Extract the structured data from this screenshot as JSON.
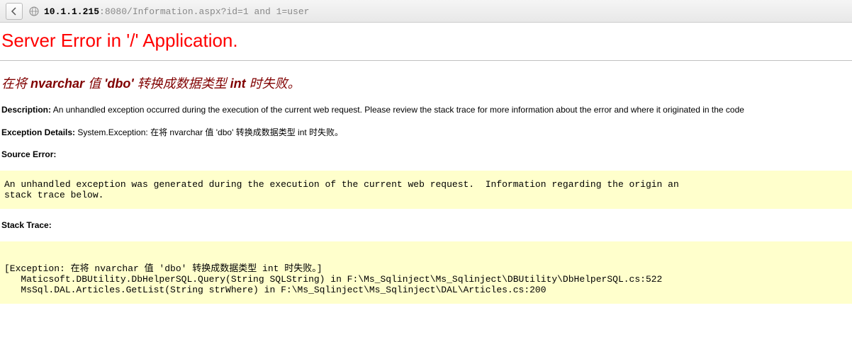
{
  "browser": {
    "url_host": "10.1.1.215",
    "url_path": ":8080/Information.aspx?id=1 and 1=user"
  },
  "error": {
    "title": "Server Error in '/' Application.",
    "message_prefix": "在将 ",
    "message_kw1": "nvarchar",
    "message_mid1": " 值 ",
    "message_kw2": "'dbo'",
    "message_mid2": " 转换成数据类型 ",
    "message_kw3": "int",
    "message_suffix": " 时失败。",
    "description_label": "Description:",
    "description_text": " An unhandled exception occurred during the execution of the current web request. Please review the stack trace for more information about the error and where it originated in the code",
    "exception_label": "Exception Details:",
    "exception_text": " System.Exception: 在将 nvarchar 值 'dbo' 转换成数据类型 int 时失败。",
    "source_error_label": "Source Error:",
    "source_error_block": "An unhandled exception was generated during the execution of the current web request.  Information regarding the origin an\nstack trace below.",
    "stack_trace_label": "Stack Trace:",
    "stack_trace_block": "\n[Exception: 在将 nvarchar 值 'dbo' 转换成数据类型 int 时失败。]\n   Maticsoft.DBUtility.DbHelperSQL.Query(String SQLString) in F:\\Ms_Sqlinject\\Ms_Sqlinject\\DBUtility\\DbHelperSQL.cs:522\n   MsSql.DAL.Articles.GetList(String strWhere) in F:\\Ms_Sqlinject\\Ms_Sqlinject\\DAL\\Articles.cs:200"
  }
}
